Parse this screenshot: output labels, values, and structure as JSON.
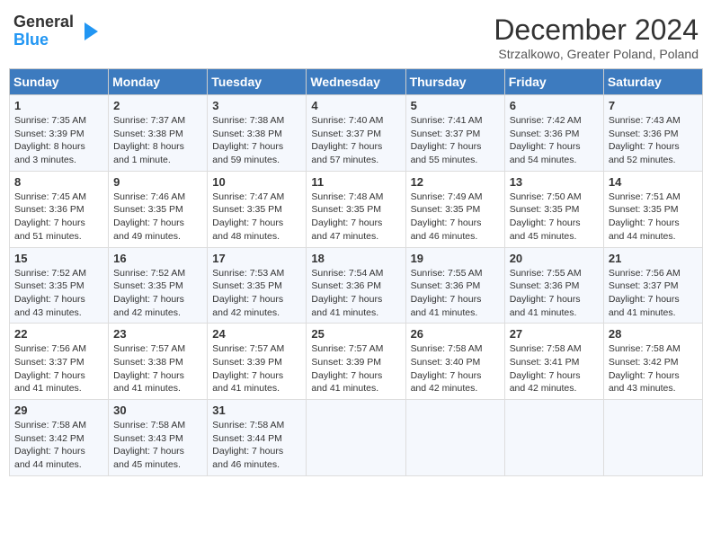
{
  "logo": {
    "general": "General",
    "blue": "Blue"
  },
  "title": "December 2024",
  "subtitle": "Strzalkowo, Greater Poland, Poland",
  "weekdays": [
    "Sunday",
    "Monday",
    "Tuesday",
    "Wednesday",
    "Thursday",
    "Friday",
    "Saturday"
  ],
  "weeks": [
    [
      {
        "day": "1",
        "sunrise": "Sunrise: 7:35 AM",
        "sunset": "Sunset: 3:39 PM",
        "daylight": "Daylight: 8 hours and 3 minutes."
      },
      {
        "day": "2",
        "sunrise": "Sunrise: 7:37 AM",
        "sunset": "Sunset: 3:38 PM",
        "daylight": "Daylight: 8 hours and 1 minute."
      },
      {
        "day": "3",
        "sunrise": "Sunrise: 7:38 AM",
        "sunset": "Sunset: 3:38 PM",
        "daylight": "Daylight: 7 hours and 59 minutes."
      },
      {
        "day": "4",
        "sunrise": "Sunrise: 7:40 AM",
        "sunset": "Sunset: 3:37 PM",
        "daylight": "Daylight: 7 hours and 57 minutes."
      },
      {
        "day": "5",
        "sunrise": "Sunrise: 7:41 AM",
        "sunset": "Sunset: 3:37 PM",
        "daylight": "Daylight: 7 hours and 55 minutes."
      },
      {
        "day": "6",
        "sunrise": "Sunrise: 7:42 AM",
        "sunset": "Sunset: 3:36 PM",
        "daylight": "Daylight: 7 hours and 54 minutes."
      },
      {
        "day": "7",
        "sunrise": "Sunrise: 7:43 AM",
        "sunset": "Sunset: 3:36 PM",
        "daylight": "Daylight: 7 hours and 52 minutes."
      }
    ],
    [
      {
        "day": "8",
        "sunrise": "Sunrise: 7:45 AM",
        "sunset": "Sunset: 3:36 PM",
        "daylight": "Daylight: 7 hours and 51 minutes."
      },
      {
        "day": "9",
        "sunrise": "Sunrise: 7:46 AM",
        "sunset": "Sunset: 3:35 PM",
        "daylight": "Daylight: 7 hours and 49 minutes."
      },
      {
        "day": "10",
        "sunrise": "Sunrise: 7:47 AM",
        "sunset": "Sunset: 3:35 PM",
        "daylight": "Daylight: 7 hours and 48 minutes."
      },
      {
        "day": "11",
        "sunrise": "Sunrise: 7:48 AM",
        "sunset": "Sunset: 3:35 PM",
        "daylight": "Daylight: 7 hours and 47 minutes."
      },
      {
        "day": "12",
        "sunrise": "Sunrise: 7:49 AM",
        "sunset": "Sunset: 3:35 PM",
        "daylight": "Daylight: 7 hours and 46 minutes."
      },
      {
        "day": "13",
        "sunrise": "Sunrise: 7:50 AM",
        "sunset": "Sunset: 3:35 PM",
        "daylight": "Daylight: 7 hours and 45 minutes."
      },
      {
        "day": "14",
        "sunrise": "Sunrise: 7:51 AM",
        "sunset": "Sunset: 3:35 PM",
        "daylight": "Daylight: 7 hours and 44 minutes."
      }
    ],
    [
      {
        "day": "15",
        "sunrise": "Sunrise: 7:52 AM",
        "sunset": "Sunset: 3:35 PM",
        "daylight": "Daylight: 7 hours and 43 minutes."
      },
      {
        "day": "16",
        "sunrise": "Sunrise: 7:52 AM",
        "sunset": "Sunset: 3:35 PM",
        "daylight": "Daylight: 7 hours and 42 minutes."
      },
      {
        "day": "17",
        "sunrise": "Sunrise: 7:53 AM",
        "sunset": "Sunset: 3:35 PM",
        "daylight": "Daylight: 7 hours and 42 minutes."
      },
      {
        "day": "18",
        "sunrise": "Sunrise: 7:54 AM",
        "sunset": "Sunset: 3:36 PM",
        "daylight": "Daylight: 7 hours and 41 minutes."
      },
      {
        "day": "19",
        "sunrise": "Sunrise: 7:55 AM",
        "sunset": "Sunset: 3:36 PM",
        "daylight": "Daylight: 7 hours and 41 minutes."
      },
      {
        "day": "20",
        "sunrise": "Sunrise: 7:55 AM",
        "sunset": "Sunset: 3:36 PM",
        "daylight": "Daylight: 7 hours and 41 minutes."
      },
      {
        "day": "21",
        "sunrise": "Sunrise: 7:56 AM",
        "sunset": "Sunset: 3:37 PM",
        "daylight": "Daylight: 7 hours and 41 minutes."
      }
    ],
    [
      {
        "day": "22",
        "sunrise": "Sunrise: 7:56 AM",
        "sunset": "Sunset: 3:37 PM",
        "daylight": "Daylight: 7 hours and 41 minutes."
      },
      {
        "day": "23",
        "sunrise": "Sunrise: 7:57 AM",
        "sunset": "Sunset: 3:38 PM",
        "daylight": "Daylight: 7 hours and 41 minutes."
      },
      {
        "day": "24",
        "sunrise": "Sunrise: 7:57 AM",
        "sunset": "Sunset: 3:39 PM",
        "daylight": "Daylight: 7 hours and 41 minutes."
      },
      {
        "day": "25",
        "sunrise": "Sunrise: 7:57 AM",
        "sunset": "Sunset: 3:39 PM",
        "daylight": "Daylight: 7 hours and 41 minutes."
      },
      {
        "day": "26",
        "sunrise": "Sunrise: 7:58 AM",
        "sunset": "Sunset: 3:40 PM",
        "daylight": "Daylight: 7 hours and 42 minutes."
      },
      {
        "day": "27",
        "sunrise": "Sunrise: 7:58 AM",
        "sunset": "Sunset: 3:41 PM",
        "daylight": "Daylight: 7 hours and 42 minutes."
      },
      {
        "day": "28",
        "sunrise": "Sunrise: 7:58 AM",
        "sunset": "Sunset: 3:42 PM",
        "daylight": "Daylight: 7 hours and 43 minutes."
      }
    ],
    [
      {
        "day": "29",
        "sunrise": "Sunrise: 7:58 AM",
        "sunset": "Sunset: 3:42 PM",
        "daylight": "Daylight: 7 hours and 44 minutes."
      },
      {
        "day": "30",
        "sunrise": "Sunrise: 7:58 AM",
        "sunset": "Sunset: 3:43 PM",
        "daylight": "Daylight: 7 hours and 45 minutes."
      },
      {
        "day": "31",
        "sunrise": "Sunrise: 7:58 AM",
        "sunset": "Sunset: 3:44 PM",
        "daylight": "Daylight: 7 hours and 46 minutes."
      },
      null,
      null,
      null,
      null
    ]
  ]
}
